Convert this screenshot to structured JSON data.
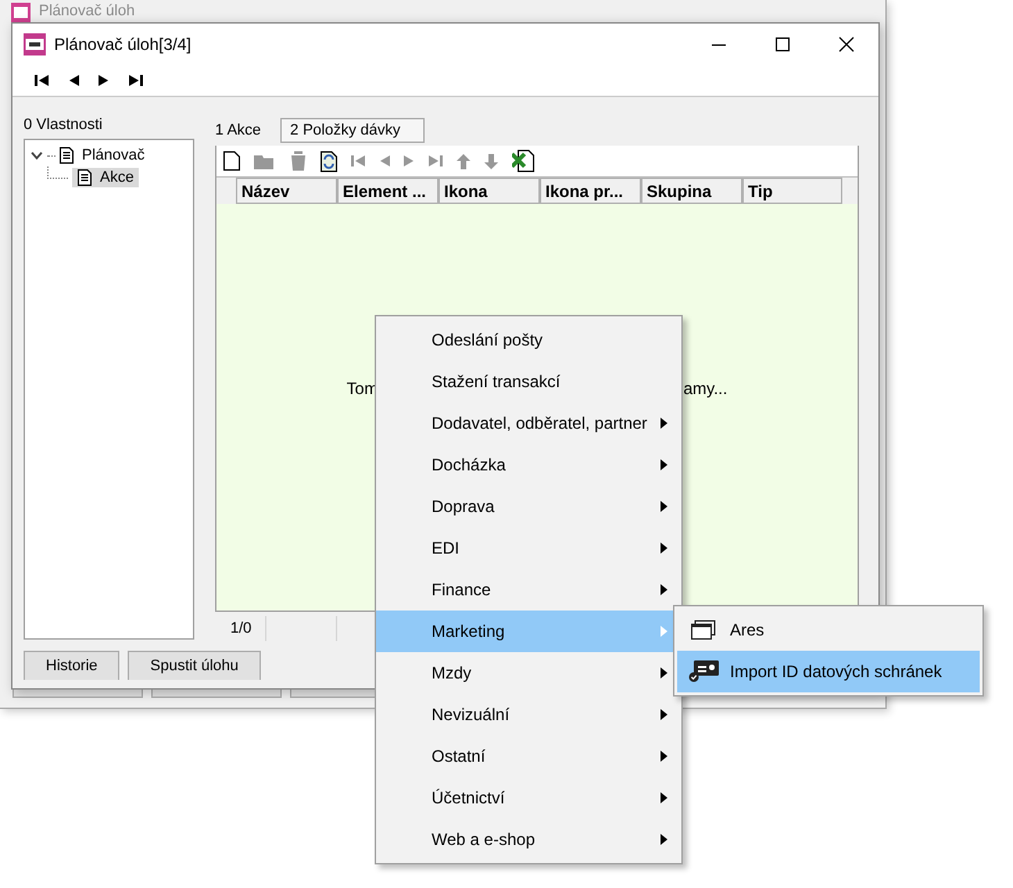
{
  "background_window": {
    "title": "Plánovač úloh"
  },
  "window": {
    "title": "Plánovač úloh[3/4]"
  },
  "nav_toolbar": [
    {
      "kind": "first"
    },
    {
      "kind": "prev"
    },
    {
      "kind": "next"
    },
    {
      "kind": "last"
    }
  ],
  "properties_label": "0 Vlastnosti",
  "tree": [
    {
      "label": "Plánovač",
      "expanded": true,
      "selected": false,
      "children": [
        {
          "label": "Akce",
          "selected": true
        }
      ]
    }
  ],
  "tabs": [
    {
      "label": "1 Akce",
      "selected": true
    },
    {
      "label": "2 Položky dávky",
      "selected": false
    }
  ],
  "grid_toolbar": [
    {
      "kind": "new",
      "disabled": false
    },
    {
      "kind": "open",
      "disabled": true
    },
    {
      "kind": "delete",
      "disabled": true
    },
    {
      "kind": "refresh",
      "disabled": false
    },
    {
      "kind": "first",
      "disabled": true
    },
    {
      "kind": "prev",
      "disabled": true
    },
    {
      "kind": "next",
      "disabled": true
    },
    {
      "kind": "last",
      "disabled": true
    },
    {
      "kind": "up",
      "disabled": true
    },
    {
      "kind": "down",
      "disabled": true
    },
    {
      "kind": "excel",
      "disabled": false
    }
  ],
  "table": {
    "columns": [
      "Název",
      "Element ...",
      "Ikona",
      "Ikona pr...",
      "Skupina",
      "Tip"
    ],
    "empty_message_start": "Tom",
    "empty_message_end": "amy..."
  },
  "status_bar": [
    "1/0"
  ],
  "buttons": [
    "Historie",
    "Spustit úlohu"
  ],
  "context_menu": [
    {
      "label": "Odeslání pošty",
      "submenu": false,
      "selected": false
    },
    {
      "label": "Stažení transakcí",
      "submenu": false,
      "selected": false
    },
    {
      "label": "Dodavatel, odběratel, partner",
      "submenu": true,
      "selected": false
    },
    {
      "label": "Docházka",
      "submenu": true,
      "selected": false
    },
    {
      "label": "Doprava",
      "submenu": true,
      "selected": false
    },
    {
      "label": "EDI",
      "submenu": true,
      "selected": false
    },
    {
      "label": "Finance",
      "submenu": true,
      "selected": false
    },
    {
      "label": "Marketing",
      "submenu": true,
      "selected": true
    },
    {
      "label": "Mzdy",
      "submenu": true,
      "selected": false
    },
    {
      "label": "Nevizuální",
      "submenu": true,
      "selected": false
    },
    {
      "label": "Ostatní",
      "submenu": true,
      "selected": false
    },
    {
      "label": "Účetnictví",
      "submenu": true,
      "selected": false
    },
    {
      "label": "Web a e-shop",
      "submenu": true,
      "selected": false
    }
  ],
  "submenu": [
    {
      "label": "Ares",
      "kind": "window",
      "selected": false
    },
    {
      "label": "Import ID datových schránek",
      "kind": "card",
      "selected": true
    }
  ]
}
